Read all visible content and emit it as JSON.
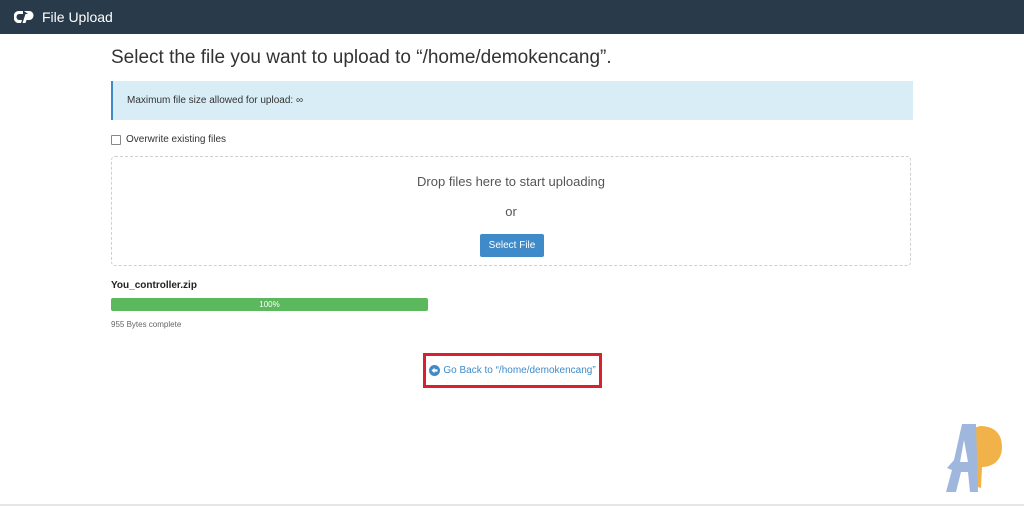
{
  "header": {
    "app_title": "File Upload",
    "logo_icon": "cpanel-logo-icon"
  },
  "main": {
    "title": "Select the file you want to upload to “/home/demokencang”.",
    "info_text": "Maximum file size allowed for upload: ∞",
    "overwrite_label": "Overwrite existing files",
    "overwrite_checked": false,
    "dropzone": {
      "drop_text": "Drop files here to start uploading",
      "or_text": "or",
      "select_button": "Select File"
    },
    "upload": {
      "filename": "You_controller.zip",
      "progress_label": "100%",
      "progress_percent": 100,
      "bytes_text": "955 Bytes complete"
    },
    "back_link": {
      "label": "Go Back to “/home/demokencang”",
      "icon": "arrow-circle-left-icon"
    }
  },
  "colors": {
    "header_bg": "#293a4a",
    "accent": "#3f8bca",
    "info_bg": "#d9edf7",
    "progress": "#5cb85c",
    "highlight": "#d9202f"
  }
}
